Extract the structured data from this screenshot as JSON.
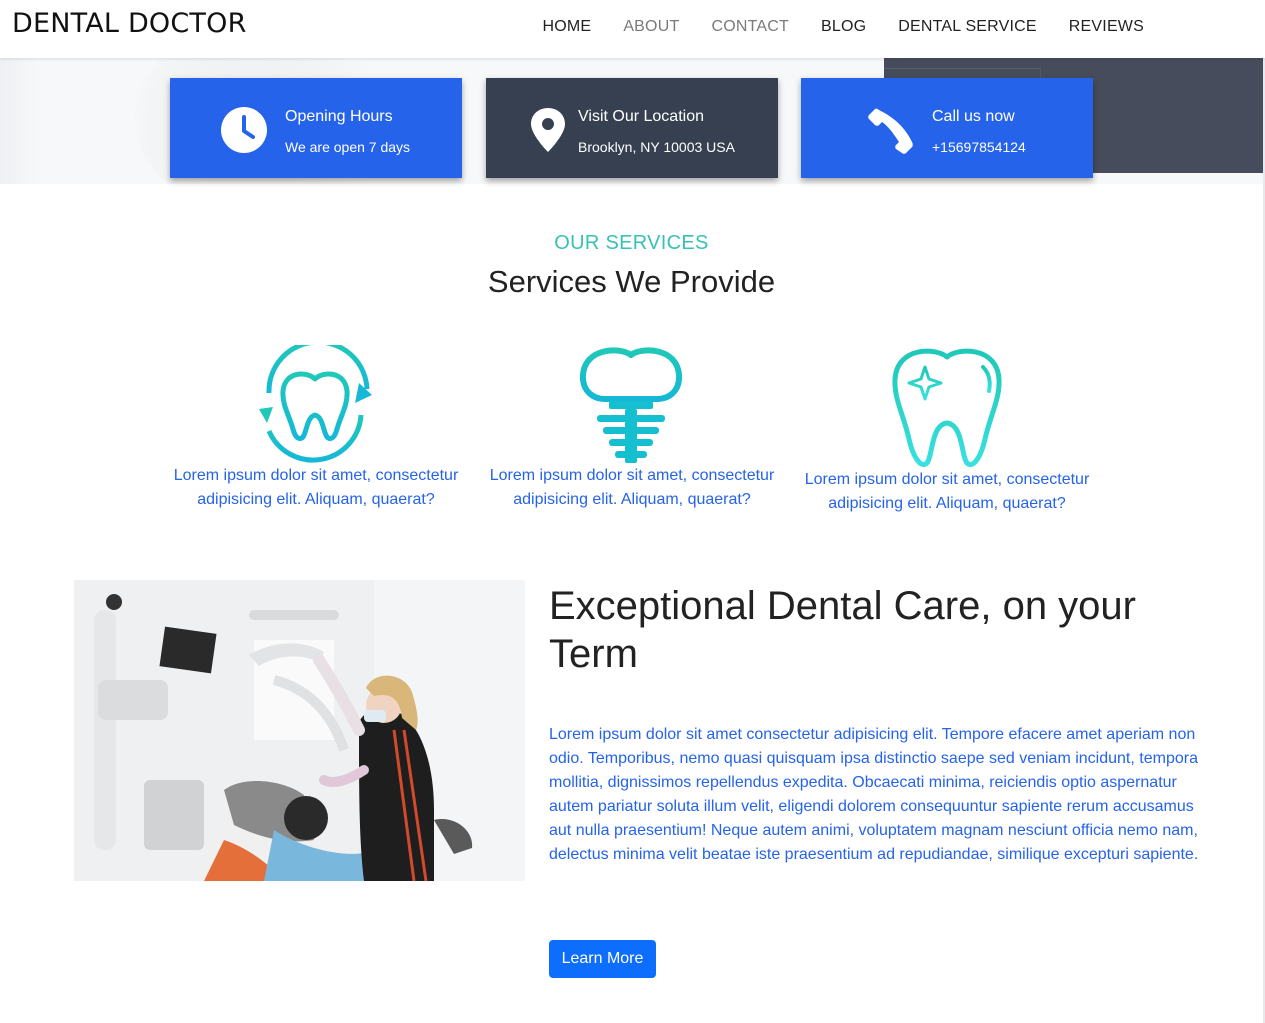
{
  "brand": "DENTAL DOCTOR",
  "nav": {
    "items": [
      {
        "label": "HOME"
      },
      {
        "label": "ABOUT"
      },
      {
        "label": "CONTACT"
      },
      {
        "label": "BLOG"
      },
      {
        "label": "DENTAL SERVICE"
      },
      {
        "label": "REVIEWS"
      }
    ]
  },
  "info_cards": [
    {
      "title": "Opening Hours",
      "sub": "We are open 7 days",
      "icon": "clock-icon",
      "color": "#2563eb"
    },
    {
      "title": "Visit Our Location",
      "sub": "Brooklyn, NY 10003 USA",
      "icon": "location-pin-icon",
      "color": "#374051"
    },
    {
      "title": "Call us now",
      "sub": "+15697854124",
      "icon": "phone-icon",
      "color": "#2563eb"
    }
  ],
  "services": {
    "eyebrow": "OUR SERVICES",
    "heading": "Services We Provide",
    "items": [
      {
        "icon": "tooth-care-cycle-icon",
        "text": "Lorem ipsum dolor sit amet, consectetur adipisicing elit. Aliquam, quaerat?"
      },
      {
        "icon": "dental-implant-icon",
        "text": "Lorem ipsum dolor sit amet, consectetur adipisicing elit. Aliquam, quaerat?"
      },
      {
        "icon": "sparkling-tooth-icon",
        "text": "Lorem ipsum dolor sit amet, consectetur adipisicing elit. Aliquam, quaerat?"
      }
    ]
  },
  "about": {
    "title": "Exceptional Dental Care, on your Term",
    "text": "Lorem ipsum dolor sit amet consectetur adipisicing elit. Tempore efacere amet aperiam non odio. Temporibus, nemo quasi quisquam ipsa distinctio saepe sed veniam incidunt, tempora mollitia, dignissimos repellendus expedita. Obcaecati minima, reiciendis optio aspernatur autem pariatur soluta illum velit, eligendi dolorem consequuntur sapiente rerum accusamus aut nulla praesentium! Neque autem animi, voluptatem magnam nesciunt officia nemo nam, delectus minima velit beatae iste praesentium ad repudiandae, similique excepturi sapiente.",
    "button": "Learn More"
  },
  "colors": {
    "accent_blue": "#2563eb",
    "dark_slate": "#374051",
    "teal": "#36c2b4",
    "button_blue": "#0d6efd"
  }
}
